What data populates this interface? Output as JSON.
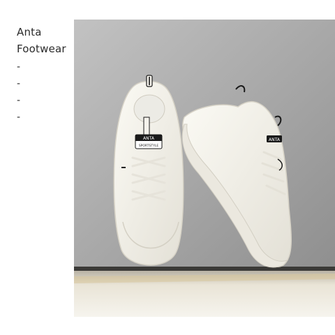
{
  "caption": {
    "brand": "Anta",
    "category": "Footwear",
    "dashes": [
      "-",
      "-",
      "-",
      "-"
    ]
  },
  "photo": {
    "subject": "white-sneakers-pair",
    "shoe_tongue_label": "ANTA",
    "shoe_tongue_sublabel": "SPORTSTYLE",
    "shoe_heel_label": "ANTA"
  },
  "colors": {
    "background": "#ffffff",
    "wall": "#a9a9a9",
    "shelf_light": "#f1efe9",
    "shoe_white": "#f4f2ea",
    "accent_black": "#1a1a1a"
  }
}
